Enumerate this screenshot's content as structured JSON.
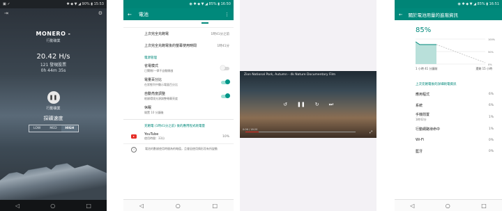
{
  "panel1": {
    "status": {
      "left": "▣ ✓",
      "right": "✱ ◆ ▼ ◢ 90% ▮ 15:53"
    },
    "name": "MONERO -",
    "subtitle": "行動礦業",
    "hashrate": "20.42 H/s",
    "shares": "121 發現股票",
    "elapsed": "0h 44m 35s",
    "action_label": "行動礦業",
    "speed_label": "採礦速度",
    "speed_options": [
      "LOW",
      "MED",
      "HIGH"
    ],
    "speed_selected": "HIGH"
  },
  "panel2": {
    "status": {
      "left": "",
      "right": "◉ ✱ ◆ ▼ ◢ 85% ▮ 16:50"
    },
    "title": "電池",
    "rows": [
      {
        "label": "上次完全充飽電",
        "value": "1時41分之前"
      },
      {
        "label": "上次完全充飽電後的螢幕使用時間",
        "value": "1時41分"
      }
    ],
    "section_power": "電源管理",
    "settings": [
      {
        "title": "省電模式",
        "desc": "已關閉/一律不自動開啟",
        "on": false
      },
      {
        "title": "電量百分比",
        "desc": "在狀態列中顯示電量百分比",
        "on": true
      },
      {
        "title": "自動亮度調整",
        "desc": "根據環境光源調整螢幕亮度",
        "on": true
      },
      {
        "title": "休眠",
        "desc": "閒置 10 分鐘後",
        "on": null
      }
    ],
    "section_usage": "充飽電 (1時41分之前) 後的應用程式耗電量",
    "app": {
      "name": "YouTube",
      "desc": "使用時間：33分",
      "pct": "10%"
    },
    "info": "電池的數據使用時間為約略值，且會因使用情形而有所變動"
  },
  "panel3": {
    "video_title": "Zion National Park, Autumn - 4k Nature Documentary Film",
    "time": "0:06 / 18:20"
  },
  "panel4": {
    "status": {
      "left": "",
      "right": "◉ ✱ ◆ ▼ ◢ 85% ▮ 16:51"
    },
    "title": "關於電池用量的進階資訊",
    "percent": "85%",
    "y_labels": [
      "100%",
      "50%",
      "0%"
    ],
    "x_left": "1 小時 41 分鐘前",
    "x_right": "還剩 15 小時",
    "section": "上次充飽電後的詳細耗電資訊",
    "items": [
      {
        "name": "應用程式",
        "sub": "",
        "pct": "6%"
      },
      {
        "name": "系統",
        "sub": "",
        "pct": "6%"
      },
      {
        "name": "手機閒置",
        "sub": "1時42分",
        "pct": "1%"
      },
      {
        "name": "行動網路待命中",
        "sub": "",
        "pct": "1%"
      },
      {
        "name": "Wi-Fi",
        "sub": "",
        "pct": "0%"
      },
      {
        "name": "藍牙",
        "sub": "",
        "pct": "0%"
      }
    ]
  },
  "nav": {
    "back": "◁",
    "home": "○",
    "recent": "□"
  },
  "colors": {
    "teal": "#00897b",
    "teal_dark": "#008577",
    "red": "#e52d27"
  },
  "icons": [
    "exit-icon",
    "settings-icon",
    "back-arrow-icon",
    "more-vert-icon",
    "pause-icon",
    "replay-icon",
    "forward-icon",
    "skip-next-icon",
    "fullscreen-icon",
    "youtube-icon",
    "info-icon"
  ]
}
